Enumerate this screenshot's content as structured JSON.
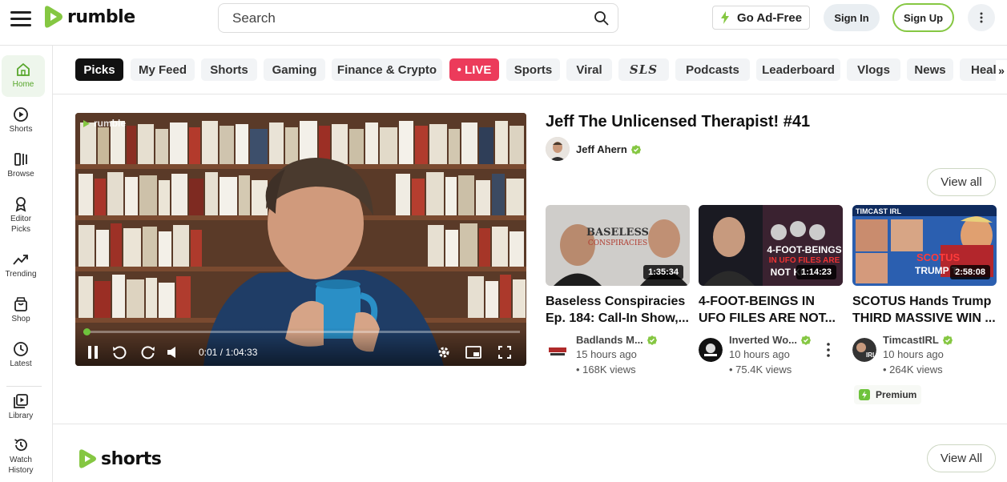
{
  "header": {
    "logo_text": "rumble",
    "search_placeholder": "Search",
    "ad_free_label": "Go Ad-Free",
    "sign_in_label": "Sign In",
    "sign_up_label": "Sign Up"
  },
  "sidebar": {
    "items": [
      {
        "label": "Home",
        "icon": "home-icon"
      },
      {
        "label": "Shorts",
        "icon": "shorts-icon"
      },
      {
        "label": "Browse",
        "icon": "browse-icon"
      },
      {
        "label": "Editor Picks",
        "icon": "award-icon"
      },
      {
        "label": "Trending",
        "icon": "trending-icon"
      },
      {
        "label": "Shop",
        "icon": "shop-icon"
      },
      {
        "label": "Latest",
        "icon": "clock-icon"
      },
      {
        "label": "Library",
        "icon": "library-icon"
      },
      {
        "label": "Watch History",
        "icon": "history-icon"
      }
    ]
  },
  "categories": [
    "Picks",
    "My Feed",
    "Shorts",
    "Gaming",
    "Finance & Crypto",
    "• LIVE",
    "Sports",
    "Viral",
    "SLS",
    "Podcasts",
    "Leaderboard",
    "Vlogs",
    "News",
    "Health"
  ],
  "player": {
    "watermark": "rumble",
    "time": "0:01 / 1:04:33",
    "progress_fraction": 0.0003
  },
  "featured": {
    "title": "Jeff The Unlicensed Therapist! #41",
    "channel": "Jeff Ahern",
    "view_all_label": "View all"
  },
  "cards": [
    {
      "title": "Baseless Conspiracies Ep. 184: Call-In Show,...",
      "duration": "1:35:34",
      "channel": "Badlands M...",
      "time": "15 hours ago",
      "views": "• 168K  views"
    },
    {
      "title": "4-FOOT-BEINGS IN UFO FILES ARE NOT...",
      "duration": "1:14:23",
      "channel": "Inverted Wo...",
      "time": "10 hours ago",
      "views": "• 75.4K  views"
    },
    {
      "title": "SCOTUS Hands Trump THIRD MASSIVE WIN ...",
      "duration": "2:58:08",
      "channel": "TimcastIRL",
      "time": "10 hours ago",
      "views": "• 264K  views",
      "badge": "Premium"
    }
  ],
  "shorts_section": {
    "logo_text": "shorts",
    "view_all_label": "View All"
  },
  "colors": {
    "brand_green": "#85c742",
    "live_red": "#ec3b5b"
  }
}
